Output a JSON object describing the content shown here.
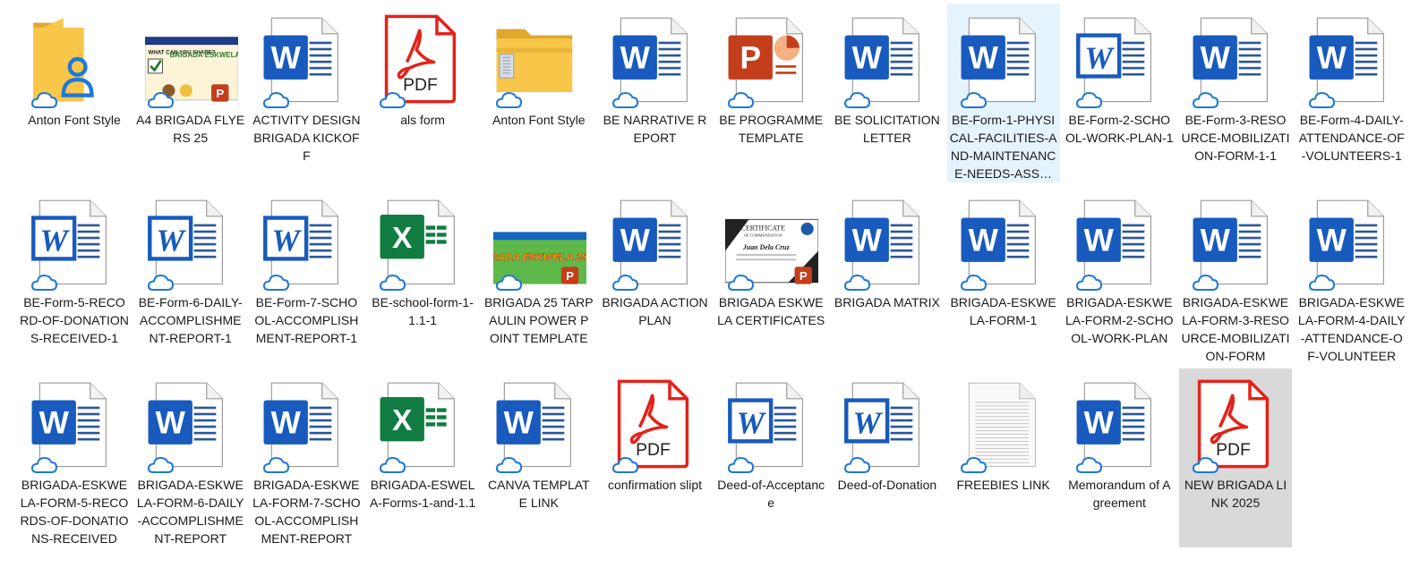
{
  "items": [
    {
      "label": "Anton Font Style",
      "icon": "folder-user-icon",
      "selected": false,
      "focused": false
    },
    {
      "label": "A4 BRIGADA FLYERS 25",
      "icon": "flyer-thumbnail-icon",
      "selected": false,
      "focused": false
    },
    {
      "label": "ACTIVITY DESIGN BRIGADA KICKOFF",
      "icon": "word-icon",
      "selected": false,
      "focused": false
    },
    {
      "label": "als form",
      "icon": "pdf-icon",
      "selected": false,
      "focused": false
    },
    {
      "label": "Anton Font Style",
      "icon": "zip-folder-icon",
      "selected": false,
      "focused": false
    },
    {
      "label": "BE NARRATIVE REPORT",
      "icon": "word-icon",
      "selected": false,
      "focused": false
    },
    {
      "label": "BE PROGRAMME TEMPLATE",
      "icon": "powerpoint-icon",
      "selected": false,
      "focused": false
    },
    {
      "label": "BE SOLICITATION LETTER",
      "icon": "word-icon",
      "selected": false,
      "focused": false
    },
    {
      "label": "BE-Form-1-PHYSICAL-FACILITIES-AND-MAINTENANCE-NEEDS-ASS…",
      "icon": "word-icon",
      "selected": true,
      "focused": false
    },
    {
      "label": "BE-Form-2-SCHOOL-WORK-PLAN-1",
      "icon": "word-legacy-icon",
      "selected": false,
      "focused": false
    },
    {
      "label": "BE-Form-3-RESOURCE-MOBILIZATION-FORM-1-1",
      "icon": "word-icon",
      "selected": false,
      "focused": false
    },
    {
      "label": "BE-Form-4-DAILY-ATTENDANCE-OF-VOLUNTEERS-1",
      "icon": "word-icon",
      "selected": false,
      "focused": false
    },
    {
      "label": "BE-Form-5-RECORD-OF-DONATIONS-RECEIVED-1",
      "icon": "word-legacy-icon",
      "selected": false,
      "focused": false
    },
    {
      "label": "BE-Form-6-DAILY-ACCOMPLISHMENT-REPORT-1",
      "icon": "word-legacy-icon",
      "selected": false,
      "focused": false
    },
    {
      "label": "BE-Form-7-SCHOOL-ACCOMPLISHMENT-REPORT-1",
      "icon": "word-legacy-icon",
      "selected": false,
      "focused": false
    },
    {
      "label": "BE-school-form-1-1.1-1",
      "icon": "excel-icon",
      "selected": false,
      "focused": false
    },
    {
      "label": "BRIGADA 25 TARPAULIN POWER POINT TEMPLATE",
      "icon": "tarpaulin-thumbnail-icon",
      "selected": false,
      "focused": false
    },
    {
      "label": "BRIGADA ACTION PLAN",
      "icon": "word-icon",
      "selected": false,
      "focused": false
    },
    {
      "label": "BRIGADA ESKWELA CERTIFICATES",
      "icon": "certificate-thumbnail-icon",
      "selected": false,
      "focused": false
    },
    {
      "label": "BRIGADA MATRIX",
      "icon": "word-icon",
      "selected": false,
      "focused": false
    },
    {
      "label": "BRIGADA-ESKWELA-FORM-1",
      "icon": "word-icon",
      "selected": false,
      "focused": false
    },
    {
      "label": "BRIGADA-ESKWELA-FORM-2-SCHOOL-WORK-PLAN",
      "icon": "word-icon",
      "selected": false,
      "focused": false
    },
    {
      "label": "BRIGADA-ESKWELA-FORM-3-RESOURCE-MOBILIZATION-FORM",
      "icon": "word-icon",
      "selected": false,
      "focused": false
    },
    {
      "label": "BRIGADA-ESKWELA-FORM-4-DAILY-ATTENDANCE-OF-VOLUNTEER",
      "icon": "word-icon",
      "selected": false,
      "focused": false
    },
    {
      "label": "BRIGADA-ESKWELA-FORM-5-RECORDS-OF-DONATIONS-RECEIVED",
      "icon": "word-icon",
      "selected": false,
      "focused": false
    },
    {
      "label": "BRIGADA-ESKWELA-FORM-6-DAILY-ACCOMPLISHMENT-REPORT",
      "icon": "word-icon",
      "selected": false,
      "focused": false
    },
    {
      "label": "BRIGADA-ESKWELA-FORM-7-SCHOOL-ACCOMPLISHMENT-REPORT",
      "icon": "word-icon",
      "selected": false,
      "focused": false
    },
    {
      "label": "BRIGADA-ESWELA-Forms-1-and-1.1",
      "icon": "excel-icon",
      "selected": false,
      "focused": false
    },
    {
      "label": "CANVA TEMPLATE LINK",
      "icon": "word-icon",
      "selected": false,
      "focused": false
    },
    {
      "label": "confirmation slipt",
      "icon": "pdf-icon",
      "selected": false,
      "focused": false
    },
    {
      "label": "Deed-of-Acceptance",
      "icon": "word-legacy-icon",
      "selected": false,
      "focused": false
    },
    {
      "label": "Deed-of-Donation",
      "icon": "word-legacy-icon",
      "selected": false,
      "focused": false
    },
    {
      "label": "FREEBIES LINK",
      "icon": "text-file-icon",
      "selected": false,
      "focused": false
    },
    {
      "label": "Memorandum of Agreement",
      "icon": "word-icon",
      "selected": false,
      "focused": false
    },
    {
      "label": "NEW BRIGADA LINK 2025",
      "icon": "pdf-icon",
      "selected": false,
      "focused": true
    }
  ],
  "badges": {
    "pdf": "PDF",
    "word": "W",
    "excel": "X",
    "powerpoint": "P"
  },
  "thumb_text": {
    "flyer_title": "BRIGADA ESKWELA 25",
    "flyer_question": "WHAT CAN YOU SHARE?",
    "tarp_title": "BRIGADA ESKWELA 25",
    "cert_title": "CERTIFICATE",
    "cert_sub": "OF COMMENDATION",
    "cert_name": "Juan Dela Cruz"
  },
  "colors": {
    "word_blue": "#185abd",
    "pdf_red": "#e2231a",
    "excel_green": "#107c41",
    "ppt_orange": "#c43e1c",
    "folder_yellow": "#f8c74a",
    "cloud_blue": "#1e78d7",
    "selected_bg": "#e5f3ff",
    "focused_bg": "#d9d9d9"
  }
}
